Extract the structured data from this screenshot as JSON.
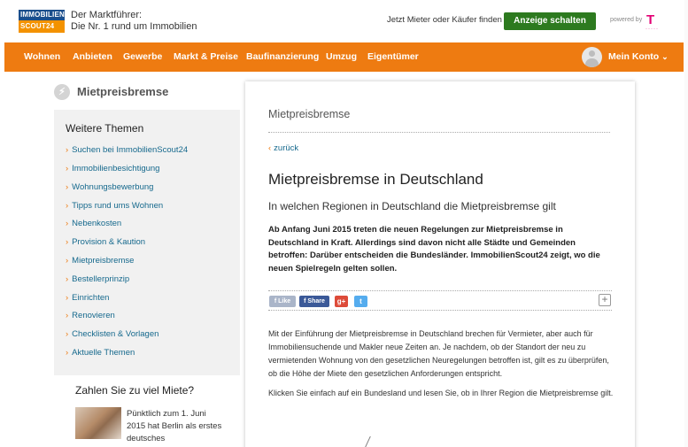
{
  "header": {
    "logo_line1": "IMMOBILIEN",
    "logo_line2": "SCOUT24",
    "tagline_line1": "Der Marktführer:",
    "tagline_line2": "Die Nr. 1 rund um Immobilien",
    "search_link": "Jetzt Mieter oder Käufer finden",
    "cta_label": "Anzeige schalten",
    "powered_by": "powered by",
    "telekom_mark": "T",
    "cta_color": "#2d7a1f"
  },
  "nav": {
    "color": "#ee7b11",
    "items": [
      "Wohnen",
      "Anbieten",
      "Gewerbe",
      "Markt & Preise",
      "Baufinanzierung",
      "Umzug",
      "Eigentümer"
    ],
    "account_label": "Mein Konto"
  },
  "sidebar": {
    "section_title": "Mietpreisbremse",
    "section_icon": "lightning-icon",
    "themes_title": "Weitere Themen",
    "items": [
      "Suchen bei ImmobilienScout24",
      "Immobilienbesichtigung",
      "Wohnungsbewerbung",
      "Tipps rund ums Wohnen",
      "Nebenkosten",
      "Provision & Kaution",
      "Mietpreisbremse",
      "Bestellerprinzip",
      "Einrichten",
      "Renovieren",
      "Checklisten & Vorlagen",
      "Aktuelle Themen"
    ],
    "teaser_title": "Zahlen Sie zu viel Miete?",
    "teaser_text": "Pünktlich zum 1. Juni 2015 hat Berlin als erstes deutsches"
  },
  "article": {
    "card_title": "Mietpreisbremse",
    "back_label": "zurück",
    "headline": "Mietpreisbremse in Deutschland",
    "subheadline": "In welchen Regionen in Deutschland die Mietpreisbremse gilt",
    "lead": "Ab Anfang Juni 2015 treten die neuen Regelungen zur Mietpreisbremse in Deutschland in Kraft. Allerdings sind davon nicht alle Städte und Gemeinden betroffen: Darüber entscheiden die Bundesländer. ImmobilienScout24 zeigt, wo die neuen Spielregeln gelten sollen.",
    "share": {
      "like": "Like",
      "share": "Share",
      "gplus": "g+",
      "twitter": "t",
      "more": "+"
    },
    "body1": "Mit der Einführung der Mietpreisbremse in Deutschland brechen für Vermieter, aber auch für Immobiliensuchende und Makler neue Zeiten an. Je nachdem, ob der Standort der neu zu vermietenden Wohnung von den gesetzlichen Neuregelungen betroffen ist, gilt es zu überprüfen, ob die Höhe der Miete den gesetzlichen Anforderungen entspricht.",
    "body2": "Klicken Sie einfach auf ein Bundesland und lesen Sie, ob in Ihrer Region die Mietpreisbremse gilt."
  }
}
